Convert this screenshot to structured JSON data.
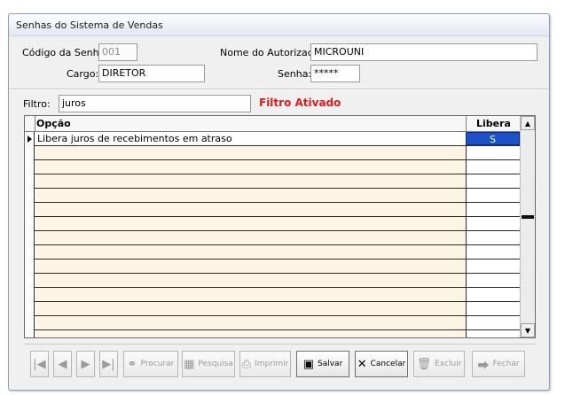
{
  "window": {
    "title": "Senhas do Sistema de Vendas"
  },
  "form": {
    "codigo_label": "Código da Senha:",
    "codigo_value": "001",
    "nome_label": "Nome do Autorizado:",
    "nome_value": "MICROUNI",
    "cargo_label": "Cargo:",
    "cargo_value": "DIRETOR",
    "senha_label": "Senha:",
    "senha_value": "*****"
  },
  "filter": {
    "label": "Filtro:",
    "value": "juros",
    "status": "Filtro Ativado"
  },
  "grid": {
    "columns": [
      "Opção",
      "Libera"
    ],
    "rows": [
      {
        "opcao": "Libera juros de recebimentos em atraso",
        "libera": "S"
      }
    ]
  },
  "toolbar": {
    "procurar": "Procurar",
    "pesquisa": "Pesquisa",
    "imprimir": "Imprimir",
    "salvar": "Salvar",
    "cancelar": "Cancelar",
    "excluir": "Excluir",
    "fechar": "Fechar"
  },
  "colors": {
    "filter_status": "#e11a1a",
    "grid_row_fill": "#fdf5e3",
    "selected_cell": "#1e50c8"
  },
  "icons": [
    "first-record-icon",
    "previous-record-icon",
    "next-record-icon",
    "last-record-icon",
    "binoculars-icon",
    "grid-icon",
    "printer-icon",
    "floppy-disk-icon",
    "cancel-x-icon",
    "trash-icon",
    "exit-icon"
  ]
}
